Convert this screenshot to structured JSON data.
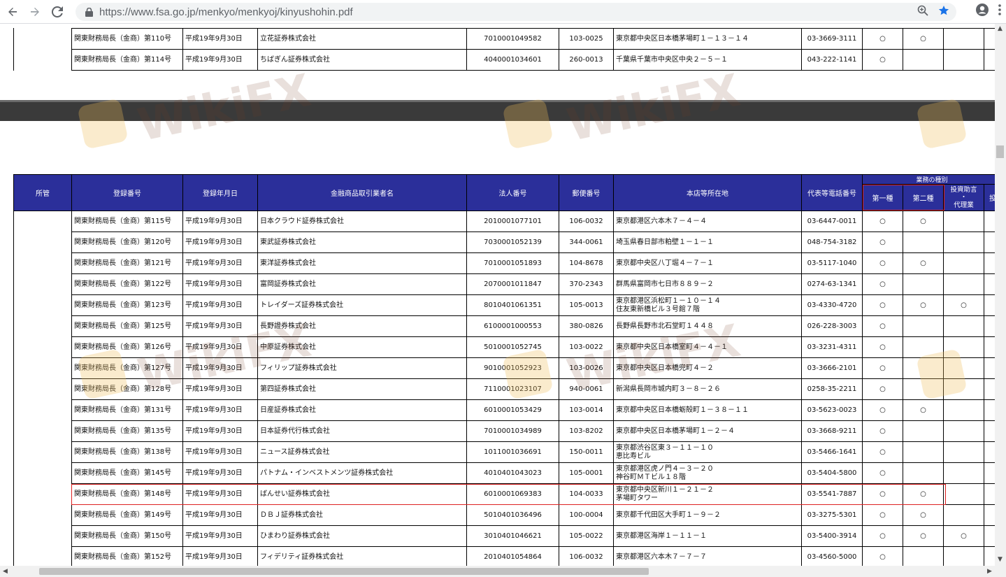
{
  "browser": {
    "url": "https://www.fsa.go.jp/menkyo/menkyoj/kinyushohin.pdf"
  },
  "top_table": {
    "rows": [
      {
        "reg": "関東財務局長（金商）第110号",
        "date": "平成19年9月30日",
        "name": "立花証券株式会社",
        "corp": "7010001049582",
        "zip": "103-0025",
        "addr1": "東京都中央区日本橋茅場町１－１３－１４",
        "addr2": "",
        "tel": "03-3669-3111",
        "k1": "○",
        "k2": "○",
        "k3": ""
      },
      {
        "reg": "関東財務局長（金商）第114号",
        "date": "平成19年9月30日",
        "name": "ちばぎん証券株式会社",
        "corp": "4040001034601",
        "zip": "260-0013",
        "addr1": "千葉県千葉市中央区中央２－５－１",
        "addr2": "",
        "tel": "043-222-1141",
        "k1": "○",
        "k2": "",
        "k3": ""
      }
    ]
  },
  "main_table": {
    "headers": {
      "shokan": "所管",
      "reg": "登録番号",
      "date": "登録年月日",
      "name": "金融商品取引業者名",
      "corp": "法人番号",
      "zip": "郵便番号",
      "addr": "本店等所在地",
      "tel": "代表等電話番号",
      "group": "業務の種別",
      "k1": "第一種",
      "k2": "第二種",
      "k3a": "投資助言",
      "k3b": "・",
      "k3c": "代理業",
      "k4": "投"
    },
    "rows": [
      {
        "reg": "関東財務局長（金商）第115号",
        "date": "平成19年9月30日",
        "name": "日本クラウド証券株式会社",
        "corp": "2010001077101",
        "zip": "106-0032",
        "addr1": "東京都港区六本木７－４－４",
        "addr2": "",
        "tel": "03-6447-0011",
        "k1": "○",
        "k2": "○",
        "k3": ""
      },
      {
        "reg": "関東財務局長（金商）第120号",
        "date": "平成19年9月30日",
        "name": "東武証券株式会社",
        "corp": "7030001052139",
        "zip": "344-0061",
        "addr1": "埼玉県春日部市粕壁１－１－１",
        "addr2": "",
        "tel": "048-754-3182",
        "k1": "○",
        "k2": "",
        "k3": ""
      },
      {
        "reg": "関東財務局長（金商）第121号",
        "date": "平成19年9月30日",
        "name": "東洋証券株式会社",
        "corp": "7010001051893",
        "zip": "104-8678",
        "addr1": "東京都中央区八丁堀４－７－１",
        "addr2": "",
        "tel": "03-5117-1040",
        "k1": "○",
        "k2": "○",
        "k3": ""
      },
      {
        "reg": "関東財務局長（金商）第122号",
        "date": "平成19年9月30日",
        "name": "富岡証券株式会社",
        "corp": "2070001011847",
        "zip": "370-2343",
        "addr1": "群馬県富岡市七日市８８９－２",
        "addr2": "",
        "tel": "0274-63-1341",
        "k1": "○",
        "k2": "",
        "k3": ""
      },
      {
        "reg": "関東財務局長（金商）第123号",
        "date": "平成19年9月30日",
        "name": "トレイダーズ証券株式会社",
        "corp": "8010401061351",
        "zip": "105-0013",
        "addr1": "東京都港区浜松町１－１０－１４",
        "addr2": "住友東新橋ビル３号館７階",
        "tel": "03-4330-4720",
        "k1": "○",
        "k2": "○",
        "k3": "○"
      },
      {
        "reg": "関東財務局長（金商）第125号",
        "date": "平成19年9月30日",
        "name": "長野證券株式会社",
        "corp": "6100001000553",
        "zip": "380-0826",
        "addr1": "長野県長野市北石堂町１４４８",
        "addr2": "",
        "tel": "026-228-3003",
        "k1": "○",
        "k2": "",
        "k3": ""
      },
      {
        "reg": "関東財務局長（金商）第126号",
        "date": "平成19年9月30日",
        "name": "中原証券株式会社",
        "corp": "5010001052745",
        "zip": "103-0022",
        "addr1": "東京都中央区日本橋室町４－４－１",
        "addr2": "",
        "tel": "03-3231-4311",
        "k1": "○",
        "k2": "",
        "k3": ""
      },
      {
        "reg": "関東財務局長（金商）第127号",
        "date": "平成19年9月30日",
        "name": "フィリップ証券株式会社",
        "corp": "9010001052923",
        "zip": "103-0026",
        "addr1": "東京都中央区日本橋兜町４－２",
        "addr2": "",
        "tel": "03-3666-2101",
        "k1": "○",
        "k2": "",
        "k3": ""
      },
      {
        "reg": "関東財務局長（金商）第128号",
        "date": "平成19年9月30日",
        "name": "第四証券株式会社",
        "corp": "7110001023107",
        "zip": "940-0061",
        "addr1": "新潟県長岡市城内町３－８－２６",
        "addr2": "",
        "tel": "0258-35-2211",
        "k1": "○",
        "k2": "",
        "k3": ""
      },
      {
        "reg": "関東財務局長（金商）第131号",
        "date": "平成19年9月30日",
        "name": "日産証券株式会社",
        "corp": "6010001053429",
        "zip": "103-0014",
        "addr1": "東京都中央区日本橋蛎殻町１－３８－１１",
        "addr2": "",
        "tel": "03-5623-0023",
        "k1": "○",
        "k2": "○",
        "k3": ""
      },
      {
        "reg": "関東財務局長（金商）第135号",
        "date": "平成19年9月30日",
        "name": "日本証券代行株式会社",
        "corp": "7010001034989",
        "zip": "103-8202",
        "addr1": "東京都中央区日本橋茅場町１－２－４",
        "addr2": "",
        "tel": "03-3668-9211",
        "k1": "○",
        "k2": "",
        "k3": ""
      },
      {
        "reg": "関東財務局長（金商）第138号",
        "date": "平成19年9月30日",
        "name": "ニュース証券株式会社",
        "corp": "1011001036691",
        "zip": "150-0011",
        "addr1": "東京都渋谷区東３－１１－１０",
        "addr2": "恵比寿ビル",
        "tel": "03-5466-1641",
        "k1": "○",
        "k2": "",
        "k3": ""
      },
      {
        "reg": "関東財務局長（金商）第145号",
        "date": "平成19年9月30日",
        "name": "パトナム・インベストメンツ証券株式会社",
        "corp": "4010401043023",
        "zip": "105-0001",
        "addr1": "東京都港区虎ノ門４－３－２０",
        "addr2": "神谷町ＭＴビル１８階",
        "tel": "03-5404-5800",
        "k1": "○",
        "k2": "",
        "k3": ""
      },
      {
        "reg": "関東財務局長（金商）第148号",
        "date": "平成19年9月30日",
        "name": "ばんせい証券株式会社",
        "corp": "6010001069383",
        "zip": "104-0033",
        "addr1": "東京都中央区新川１－２１－２",
        "addr2": "茅場町タワー",
        "tel": "03-5541-7887",
        "k1": "○",
        "k2": "○",
        "k3": ""
      },
      {
        "reg": "関東財務局長（金商）第149号",
        "date": "平成19年9月30日",
        "name": "ＤＢＪ証券株式会社",
        "corp": "5010401036496",
        "zip": "100-0004",
        "addr1": "東京都千代田区大手町１－９－２",
        "addr2": "",
        "tel": "03-3275-5301",
        "k1": "○",
        "k2": "○",
        "k3": ""
      },
      {
        "reg": "関東財務局長（金商）第150号",
        "date": "平成19年9月30日",
        "name": "ひまわり証券株式会社",
        "corp": "3010401046621",
        "zip": "105-0022",
        "addr1": "東京都港区海岸１－１１－１",
        "addr2": "",
        "tel": "03-5400-3914",
        "k1": "○",
        "k2": "○",
        "k3": "○"
      },
      {
        "reg": "関東財務局長（金商）第152号",
        "date": "平成19年9月30日",
        "name": "フィデリティ証券株式会社",
        "corp": "2010401054864",
        "zip": "106-0032",
        "addr1": "東京都港区六本木７－７－７",
        "addr2": "",
        "tel": "03-4560-5000",
        "k1": "○",
        "k2": "",
        "k3": ""
      }
    ]
  },
  "watermark": {
    "text": "WikiFX"
  }
}
